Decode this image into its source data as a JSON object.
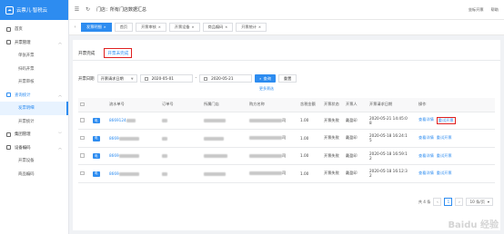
{
  "app": {
    "name": "云票儿·智税云"
  },
  "sidebar": {
    "items": [
      {
        "label": "首页"
      },
      {
        "label": "开票管理",
        "children": [
          {
            "label": "单张开票"
          },
          {
            "label": "扫码开票"
          },
          {
            "label": "开票审核"
          }
        ]
      },
      {
        "label": "查询统计",
        "children": [
          {
            "label": "发票明细"
          },
          {
            "label": "开票统计"
          }
        ]
      },
      {
        "label": "集团管理"
      },
      {
        "label": "设备编码",
        "children": [
          {
            "label": "开票设备"
          },
          {
            "label": "商品编码"
          }
        ]
      }
    ]
  },
  "topbar": {
    "store": "门店：所有门店数据汇总",
    "right_links": [
      "坐标开票",
      "帮助"
    ]
  },
  "tabs": [
    {
      "label": "发票明细",
      "active": true
    },
    {
      "label": "首页"
    },
    {
      "label": "开票审核"
    },
    {
      "label": "开票设备"
    },
    {
      "label": "商品编码"
    },
    {
      "label": "开票统计"
    }
  ],
  "subtabs": [
    {
      "label": "开票完成"
    },
    {
      "label": "开票未完成"
    }
  ],
  "filter": {
    "label": "开票日期",
    "select_value": "开票请求日期",
    "date_from": "2020-05-01",
    "separator": "-",
    "date_to": "2020-05-21",
    "search_label": "查询",
    "reset_label": "重置",
    "more_label": "更多筛选"
  },
  "table": {
    "columns": [
      "",
      "",
      "流水单号",
      "订单号",
      "所属门店",
      "购方名称",
      "含税金额",
      "开票状态",
      "开票人",
      "开票请求日期",
      "操作"
    ],
    "rows": [
      {
        "serial": "8669124",
        "amount": "1.00",
        "status": "开票失败",
        "issuer": "戴盈印",
        "date": "2020-05-21 14:45:0",
        "date2": "8",
        "buyer_end": "司"
      },
      {
        "serial": "8669",
        "amount": "1.00",
        "status": "开票失败",
        "issuer": "戴盈印",
        "date": "2020-05-18 16:24:1",
        "date2": "5",
        "buyer_end": "司"
      },
      {
        "serial": "8669",
        "amount": "1.00",
        "status": "开票失败",
        "issuer": "戴盈印",
        "date": "2020-05-18 16:59:1",
        "date2": "2",
        "buyer_end": "司"
      },
      {
        "serial": "8669",
        "amount": "1.00",
        "status": "开票失败",
        "issuer": "戴盈印",
        "date": "2020-05-18 16:12:3",
        "date2": "2",
        "buyer_end": "司"
      }
    ],
    "tag_label": "电",
    "detail_label": "查看详情",
    "retry_label": "重试开票"
  },
  "pager": {
    "total": "共 4 条",
    "current": "1",
    "page_size": "10 条/页"
  },
  "watermark": "Baidu 经验"
}
